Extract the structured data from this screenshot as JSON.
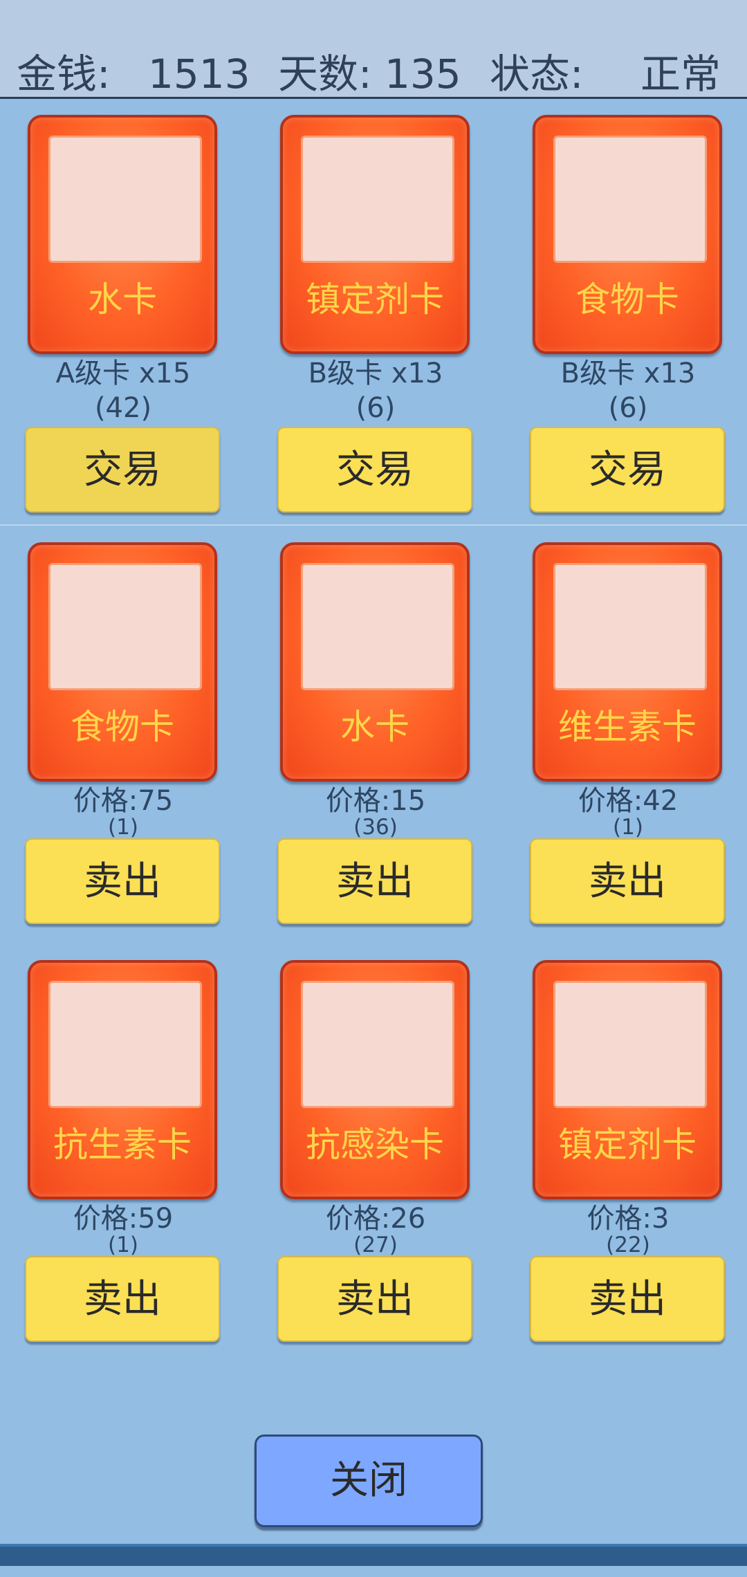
{
  "header": {
    "money_label": "金钱:",
    "money_value": "1513",
    "days_label": "天数:",
    "days_value": "135",
    "status_label": "状态:",
    "status_value": "正常"
  },
  "trade_cards": [
    {
      "name": "水卡",
      "grade": "A级卡 x15",
      "count": "(42)",
      "button": "交易"
    },
    {
      "name": "镇定剂卡",
      "grade": "B级卡 x13",
      "count": "(6)",
      "button": "交易"
    },
    {
      "name": "食物卡",
      "grade": "B级卡 x13",
      "count": "(6)",
      "button": "交易"
    }
  ],
  "sell_cards": [
    {
      "name": "食物卡",
      "price": "价格:75",
      "count": "(1)",
      "button": "卖出"
    },
    {
      "name": "水卡",
      "price": "价格:15",
      "count": "(36)",
      "button": "卖出"
    },
    {
      "name": "维生素卡",
      "price": "价格:42",
      "count": "(1)",
      "button": "卖出"
    },
    {
      "name": "抗生素卡",
      "price": "价格:59",
      "count": "(1)",
      "button": "卖出"
    },
    {
      "name": "抗感染卡",
      "price": "价格:26",
      "count": "(27)",
      "button": "卖出"
    },
    {
      "name": "镇定剂卡",
      "price": "价格:3",
      "count": "(22)",
      "button": "卖出"
    }
  ],
  "close_button": "关闭",
  "colors": {
    "background": "#93bde2",
    "card": "#ff6227",
    "card_label": "#ffd64a",
    "button": "#fbdf55",
    "close_button": "#7ea8ff"
  }
}
